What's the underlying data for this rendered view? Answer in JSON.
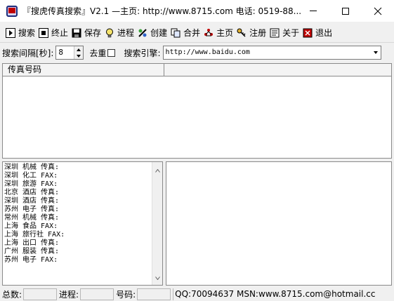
{
  "window": {
    "title": "『搜虎传真搜索』V2.1  —主页: http://www.8715.com 电话: 0519-88..."
  },
  "toolbar": {
    "buttons": [
      {
        "label": "搜索",
        "icon": "play-icon"
      },
      {
        "label": "终止",
        "icon": "stop-icon"
      },
      {
        "label": "保存",
        "icon": "save-icon"
      },
      {
        "label": "进程",
        "icon": "bulb-icon"
      },
      {
        "label": "创建",
        "icon": "create-icon"
      },
      {
        "label": "合并",
        "icon": "merge-icon"
      },
      {
        "label": "主页",
        "icon": "home-icon"
      },
      {
        "label": "注册",
        "icon": "key-icon"
      },
      {
        "label": "关于",
        "icon": "about-icon"
      },
      {
        "label": "退出",
        "icon": "exit-icon"
      }
    ]
  },
  "search": {
    "interval_label": "搜索间隔[秒]:",
    "interval_value": "8",
    "dedup_label": "去重",
    "dedup_checked": false,
    "engine_label": "搜索引擎:",
    "engine_value": "http://www.baidu.com"
  },
  "table": {
    "columns": [
      "传真号码",
      ""
    ]
  },
  "keywords": [
    "深圳 机械 传真:",
    "深圳 化工 FAX:",
    "深圳 旅游 FAX:",
    "北京 酒店 传真:",
    "深圳 酒店 传真:",
    "苏州 电子 传真:",
    "常州 机械 传真:",
    "上海 食品 FAX:",
    "上海 旅行社 FAX:",
    "上海 出口 传真:",
    "广州 服装 传真:",
    "苏州 电子 FAX:"
  ],
  "status": {
    "total_label": "总数:",
    "total_value": "",
    "progress_label": "进程:",
    "progress_value": "",
    "number_label": "号码:",
    "number_value": "",
    "contact": "QQ:70094637 MSN:www.8715.com@hotmail.cc"
  }
}
